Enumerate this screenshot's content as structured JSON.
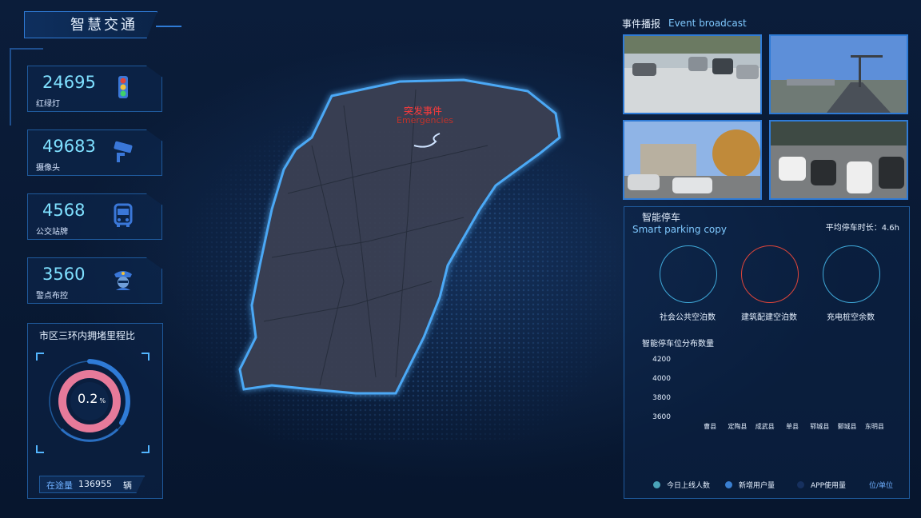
{
  "app": {
    "title": "智慧交通"
  },
  "stats": [
    {
      "value": "24695",
      "label": "红绿灯",
      "icon": "traffic-light-icon"
    },
    {
      "value": "49683",
      "label": "摄像头",
      "icon": "camera-icon"
    },
    {
      "value": "4568",
      "label": "公交站牌",
      "icon": "bus-icon"
    },
    {
      "value": "3560",
      "label": "警点布控",
      "icon": "police-icon"
    }
  ],
  "congestion": {
    "title": "市区三环内拥堵里程比",
    "value": "0.2",
    "unit": "%",
    "footer_label": "在途量",
    "footer_value": "136955",
    "footer_unit": "辆",
    "colors": {
      "ring": "#e67a9a",
      "outer": "#2f7bd6"
    }
  },
  "map": {
    "event_title": "突发事件",
    "event_sub": "Emergencies",
    "accent": "#ff3b3b"
  },
  "broadcast": {
    "title": "事件播报",
    "subtitle": "Event broadcast"
  },
  "parking": {
    "title": "智能停车",
    "subtitle": "Smart parking copy",
    "avg_label": "平均停车时长：4.6h",
    "rings": [
      {
        "label": "社会公共空泊数",
        "color": "#3fa9d9"
      },
      {
        "label": "建筑配建空泊数",
        "color": "#e0453a"
      },
      {
        "label": "充电桩空余数",
        "color": "#3fa9d9"
      }
    ],
    "chart_title": "智能停车位分布数量",
    "legend": [
      {
        "label": "今日上线人数",
        "color": "#4aa3b8"
      },
      {
        "label": "新增用户量",
        "color": "#3a7fd0"
      },
      {
        "label": "APP使用量",
        "color": "#16305e"
      }
    ],
    "unit_label": "位/单位"
  },
  "chart_data": {
    "type": "bar",
    "title": "智能停车位分布数量",
    "categories": [
      "曹县",
      "定陶县",
      "成武县",
      "单县",
      "郓城县",
      "鄄城县",
      "东明县"
    ],
    "y_ticks": [
      "4200",
      "4000",
      "3800",
      "3600"
    ],
    "ylim": [
      3600,
      4200
    ],
    "series": [
      {
        "name": "今日上线人数",
        "values": [
          3600,
          3600,
          3600,
          3600,
          3600,
          3600,
          3600
        ]
      },
      {
        "name": "新增用户量",
        "values": [
          3600,
          3600,
          3600,
          3600,
          3600,
          3600,
          3600
        ]
      },
      {
        "name": "APP使用量",
        "values": [
          3600,
          3600,
          3600,
          3600,
          3600,
          3600,
          3600
        ]
      }
    ],
    "legend_position": "bottom"
  }
}
